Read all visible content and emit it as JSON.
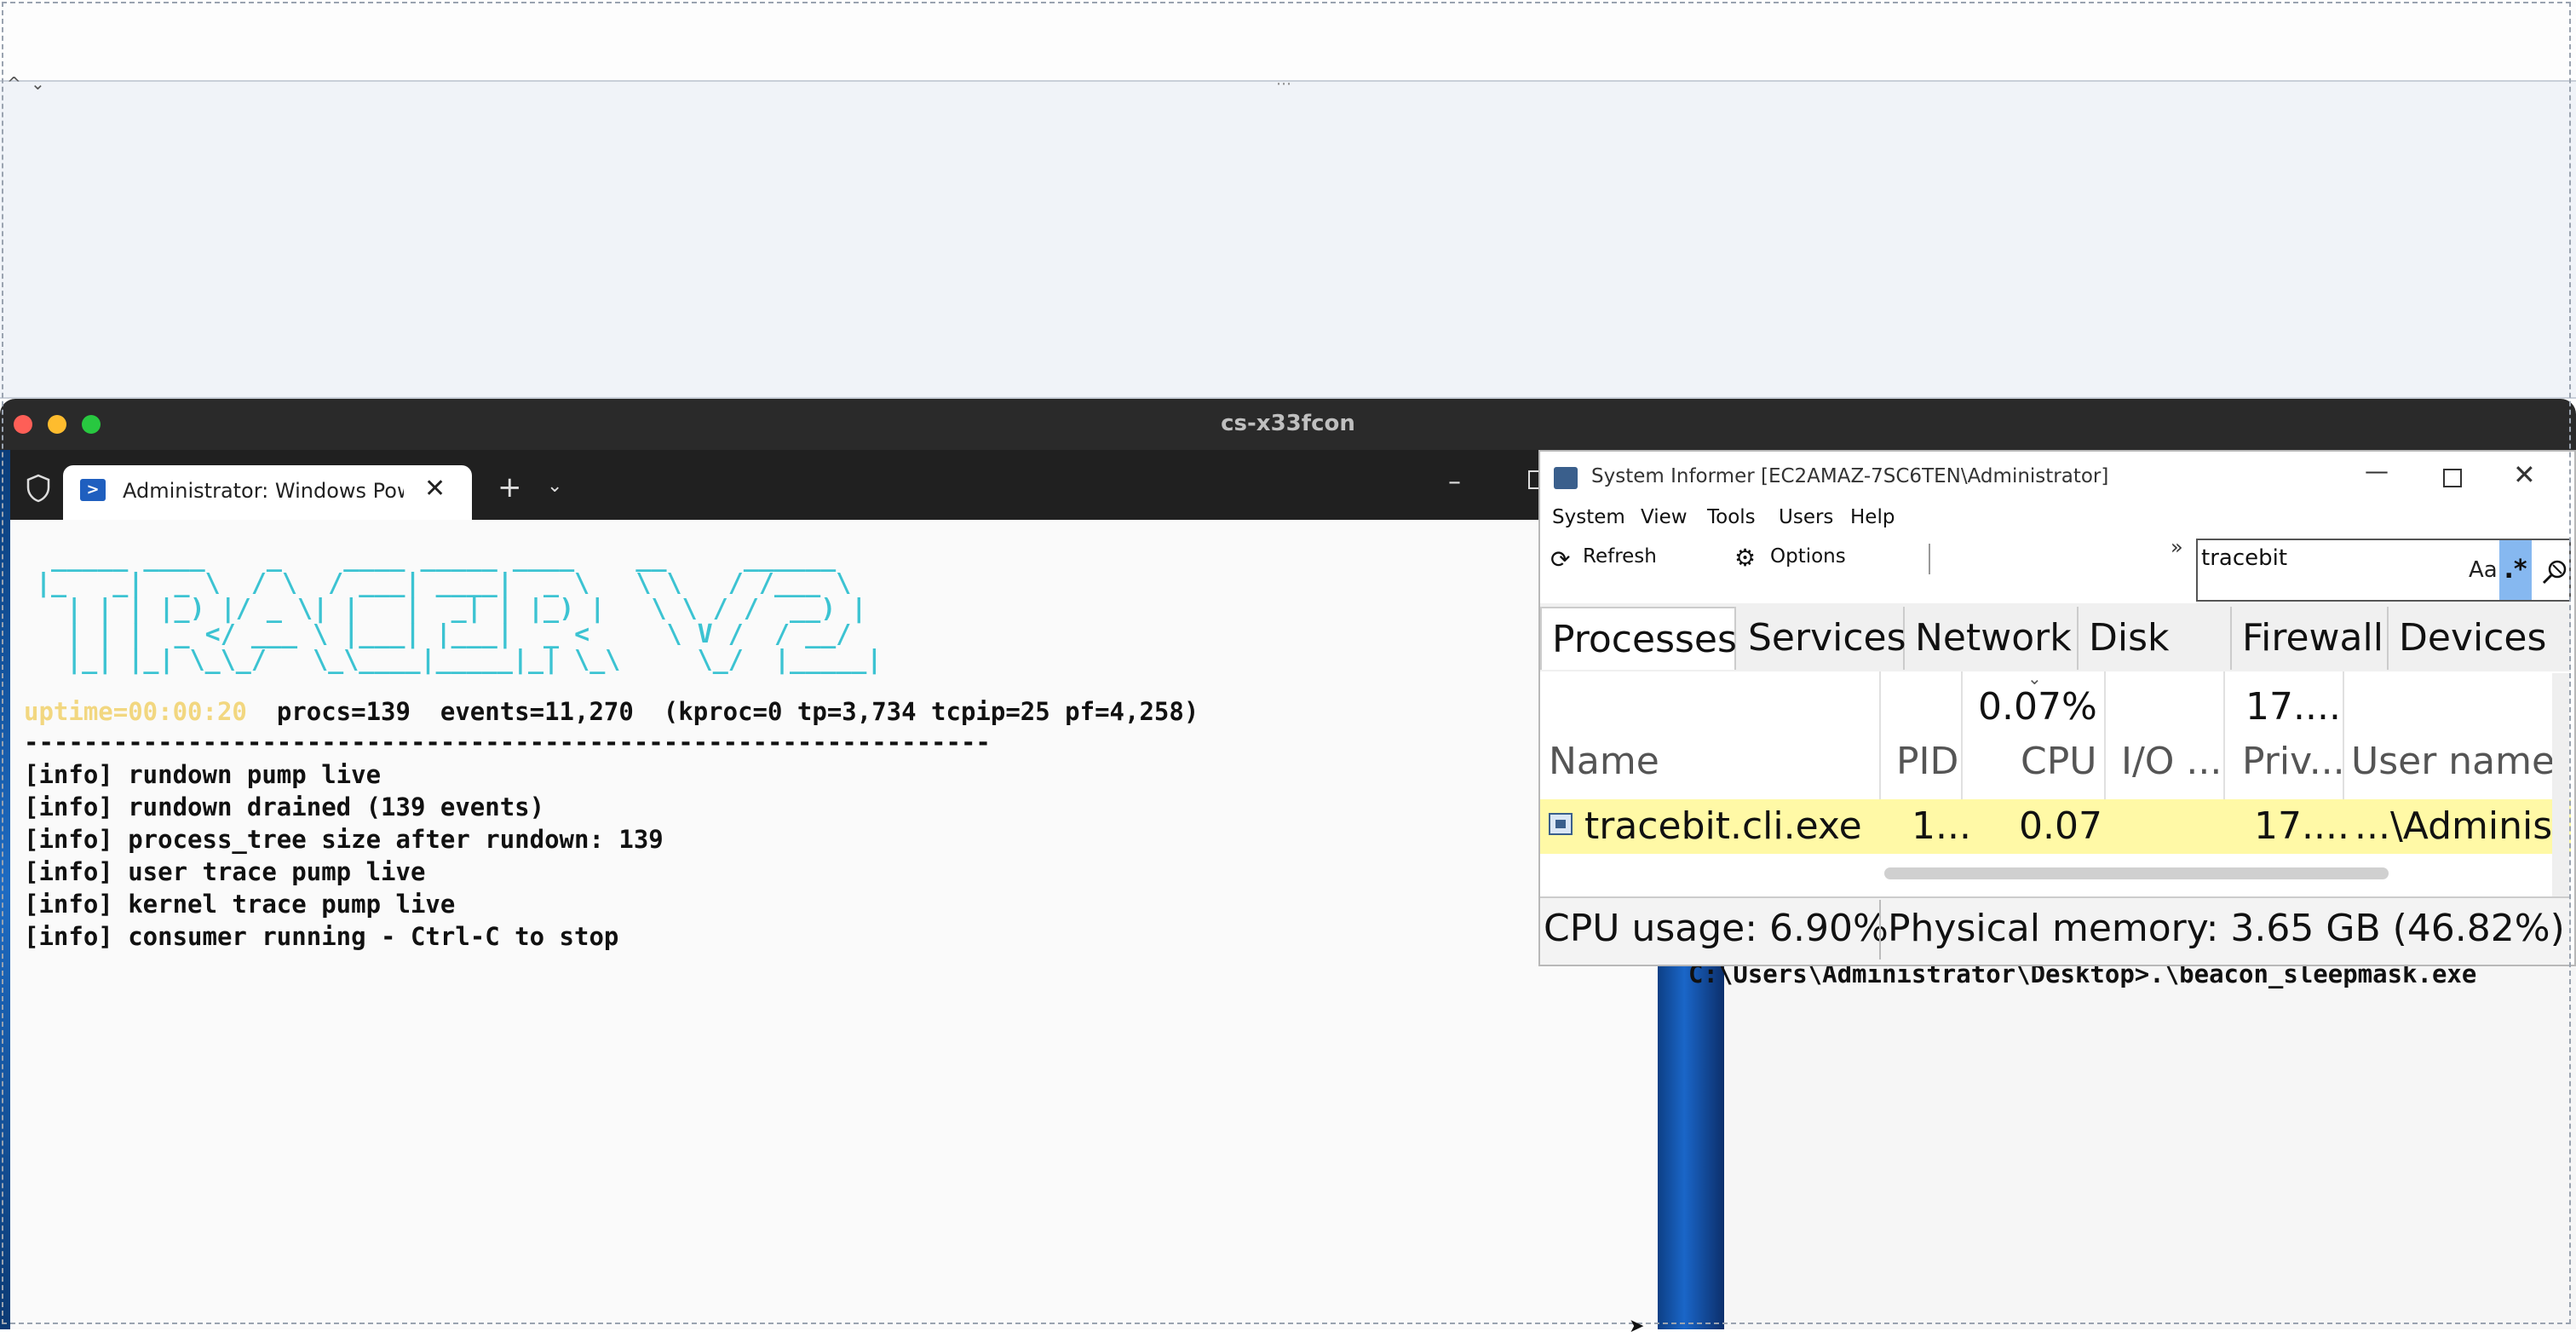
{
  "mac": {
    "window_title": "cs-x33fcon"
  },
  "terminal": {
    "tab_label": "Administrator: Windows PowerShell",
    "new_tab": "+",
    "ascii_art": " _____ ____    _    ____ _____ ____    __     ______  \n|_   _|  _ \\  / \\  / ___| ____|  _ \\   \\ \\   / /___ \\ \n  | | | |_) |/ _ \\| |   |  _| | |_) |   \\ \\ / /  __) |\n  | | |  _ </ ___ \\ |___| |___|  _ <     \\ V /  / __/ \n  |_| |_| \\_\\_/   \\_\\____|_____|_| \\_\\     \\_/  |_____|",
    "uptime": "uptime=00:00:20",
    "stats": "  procs=139  events=11,270  (kproc=0 tp=3,734 tcpip=25 pf=4,258)",
    "divider": "-----------------------------------------------------------------",
    "lines": [
      "[info] rundown pump live",
      "[info] rundown drained (139 events)",
      "[info] process_tree size after rundown: 139",
      "[info] user trace pump live",
      "[info] kernel trace pump live",
      "[info] consumer running - Ctrl-C to stop"
    ]
  },
  "system_informer": {
    "title": "System Informer [EC2AMAZ-7SC6TEN\\Administrator]",
    "menu": [
      "System",
      "View",
      "Tools",
      "Users",
      "Help"
    ],
    "toolbar": {
      "refresh": "Refresh",
      "options": "Options",
      "overflow": "»"
    },
    "search": {
      "value": "tracebit",
      "case_label": "Aa",
      "regex_label": ".*"
    },
    "tabs": [
      "Processes",
      "Services",
      "Network",
      "Disk",
      "Firewall",
      "Devices"
    ],
    "header_totals": {
      "cpu": "0.07%",
      "priv": "17...."
    },
    "columns": [
      "Name",
      "PID",
      "CPU",
      "I/O ...",
      "Priv...",
      "User name"
    ],
    "row": {
      "name": "tracebit.cli.exe",
      "pid": "1...",
      "cpu": "0.07",
      "io": "",
      "priv": "17....",
      "user": "...\\Administrator"
    },
    "status": {
      "cpu": "CPU usage: 6.90%",
      "memory": "Physical memory: 3.65 GB (46.82%)"
    }
  },
  "cmd": {
    "line": "C:\\Users\\Administrator\\Desktop>.\\beacon_sleepmask.exe"
  }
}
